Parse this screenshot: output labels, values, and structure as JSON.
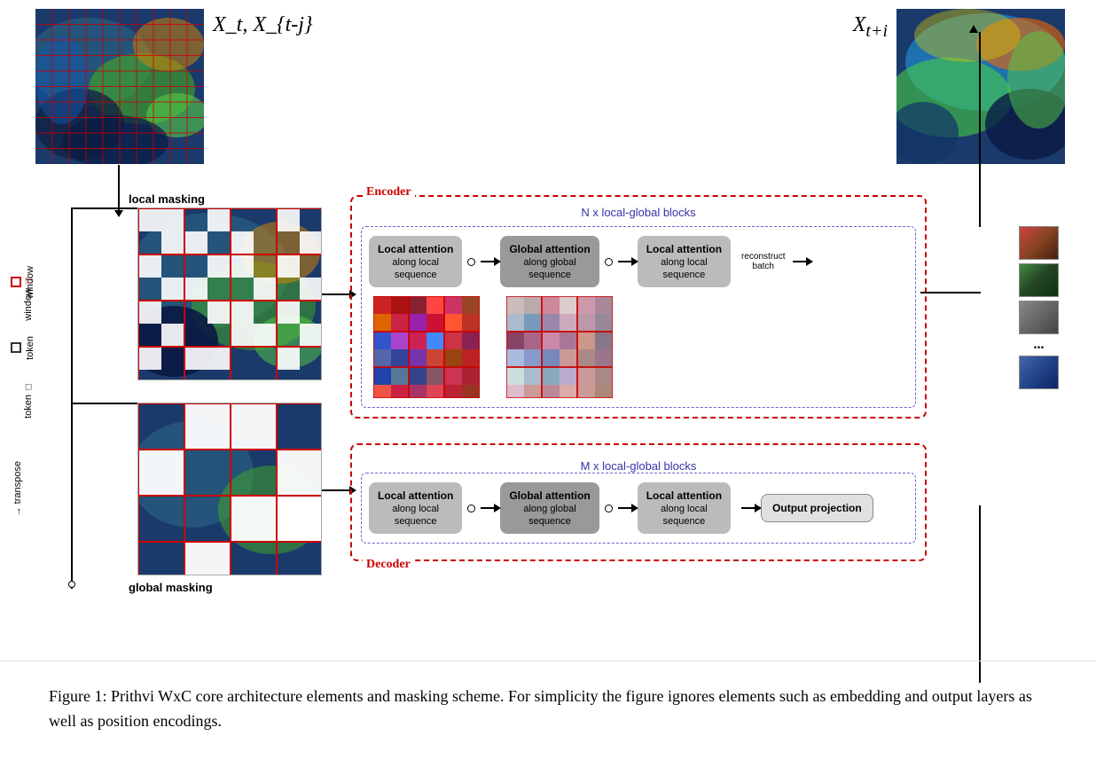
{
  "top_left_label": "X_t, X_{t-j}",
  "top_right_label": "X_{t+i}",
  "local_masking_label": "local masking",
  "global_masking_label": "global masking",
  "encoder_label": "Encoder",
  "decoder_label": "Decoder",
  "n_blocks_label": "N x local-global blocks",
  "m_blocks_label": "M x local-global blocks",
  "local_attn_1_label": "Local attention",
  "local_attn_1_sub": "along local\nsequence",
  "global_attn_label": "Global attention",
  "global_attn_sub": "along global\nsequence",
  "local_attn_2_label": "Local attention",
  "local_attn_2_sub": "along local\nsequence",
  "reconstruct_label": "reconstruct\nbatch",
  "output_proj_label": "Output projection",
  "local_attn_d1_label": "Local attention",
  "local_attn_d1_sub": "along local\nsequence",
  "global_attn_d_label": "Global attention",
  "global_attn_d_sub": "along global\nsequence",
  "local_attn_d2_label": "Local attention",
  "local_attn_d2_sub": "along local\nsequence",
  "window_label": "window",
  "token_label": "token",
  "transpose_label": "→ transpose",
  "legend_window_label": "window",
  "legend_token_label": "token",
  "figure_caption": "Figure 1: Prithvi WxC core architecture elements and masking scheme. For simplicity the figure ignores elements such as embedding and output layers as well as position encodings.",
  "colors": {
    "encoder_border": "#cc0000",
    "decoder_border": "#cc0000",
    "blocks_label": "#3333aa",
    "attention_bg": "#aaaaaa",
    "attention_bg_dark": "#888888"
  }
}
